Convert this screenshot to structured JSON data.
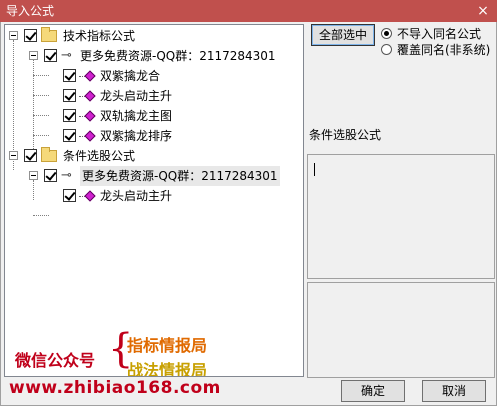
{
  "window": {
    "title": "导入公式",
    "close_glyph": "×"
  },
  "tree": {
    "nodes": [
      {
        "label": "技术指标公式",
        "type": "folder"
      },
      {
        "label": "更多免费资源-QQ群：2117284301",
        "type": "key"
      },
      {
        "label": "双紫擒龙合",
        "type": "formula"
      },
      {
        "label": "龙头启动主升",
        "type": "formula"
      },
      {
        "label": "双轨擒龙主图",
        "type": "formula"
      },
      {
        "label": "双紫擒龙排序",
        "type": "formula"
      },
      {
        "label": "条件选股公式",
        "type": "folder"
      },
      {
        "label": "更多免费资源-QQ群：2117284301",
        "type": "key"
      },
      {
        "label": "龙头启动主升",
        "type": "formula"
      }
    ]
  },
  "buttons": {
    "select_all": "全部选中",
    "ok": "确定",
    "cancel": "取消"
  },
  "options": {
    "no_import_same": "不导入同名公式",
    "overwrite_same": "覆盖同名(非系统)",
    "selected": "no_import_same"
  },
  "panel": {
    "label": "条件选股公式"
  },
  "watermark": {
    "wechat": "微信公众号",
    "brace": "{",
    "name1": "指标情报局",
    "name2": "战法情报局",
    "site": "www.zhibiao168.com"
  },
  "colors": {
    "title_bar": "#c0504d",
    "watermark_red": "#c0001a",
    "watermark_orange": "#e06a00",
    "watermark_gold": "#c8a000"
  }
}
